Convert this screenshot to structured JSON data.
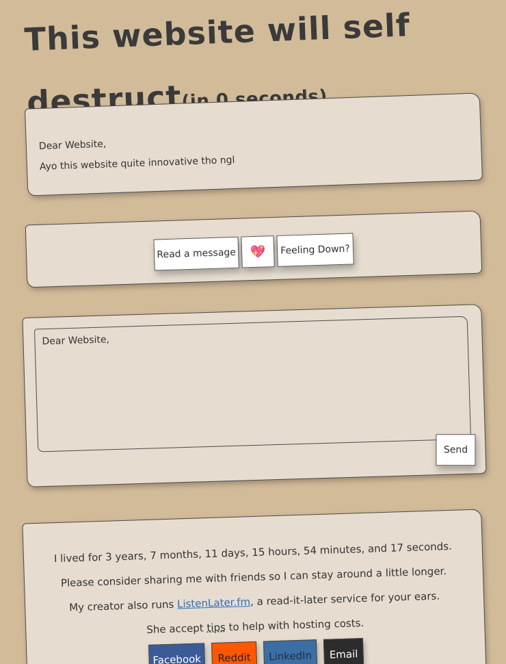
{
  "header": {
    "title_main": "This website will self destruct",
    "title_suffix": "(in 0 seconds)"
  },
  "letter": {
    "greeting": "Dear Website,",
    "body": "Ayo this website quite innovative tho ngl"
  },
  "actions": {
    "read_label": "Read a message",
    "heart_label": "💖",
    "feeling_down_label": "Feeling Down?"
  },
  "compose": {
    "value": "Dear Website,",
    "send_label": "Send"
  },
  "footer": {
    "lived": "I lived for 3 years, 7 months, 11 days, 15 hours, 54 minutes, and 17 seconds.",
    "share_prompt": "Please consider sharing me with friends so I can stay around a little longer.",
    "creator_prefix": "My creator also runs ",
    "creator_link": "ListenLater.fm",
    "creator_suffix": ", a read-it-later service for your ears.",
    "tips_prefix": "She accept ",
    "tips_link": "tips",
    "tips_suffix": " to help with hosting costs.",
    "share_buttons": {
      "facebook": "Facebook",
      "reddit": "Reddit",
      "linkedin": "LinkedIn",
      "email": "Email"
    }
  },
  "colors": {
    "background": "#d2bb99",
    "paper": "#e6ddd0",
    "facebook": "#3b5b98",
    "reddit": "#ff5700",
    "linkedin": "#3b6ea5",
    "email": "#2c2c2c",
    "link": "#2e6fb8"
  }
}
